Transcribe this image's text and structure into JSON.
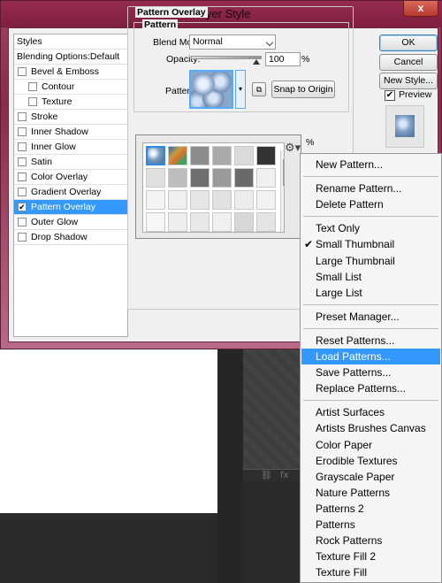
{
  "dialog": {
    "title": "Layer Style",
    "close_glyph": "x"
  },
  "styles_panel": {
    "items": [
      {
        "label": "Styles",
        "type": "header"
      },
      {
        "label": "Blending Options:Default",
        "type": "header"
      },
      {
        "label": "Bevel & Emboss",
        "checked": false
      },
      {
        "label": "Contour",
        "checked": false,
        "sub": true
      },
      {
        "label": "Texture",
        "checked": false,
        "sub": true
      },
      {
        "label": "Stroke",
        "checked": false
      },
      {
        "label": "Inner Shadow",
        "checked": false
      },
      {
        "label": "Inner Glow",
        "checked": false
      },
      {
        "label": "Satin",
        "checked": false
      },
      {
        "label": "Color Overlay",
        "checked": false
      },
      {
        "label": "Gradient Overlay",
        "checked": false
      },
      {
        "label": "Pattern Overlay",
        "checked": true,
        "selected": true
      },
      {
        "label": "Outer Glow",
        "checked": false
      },
      {
        "label": "Drop Shadow",
        "checked": false
      }
    ],
    "check_glyph": "✔"
  },
  "pattern_overlay": {
    "group_title": "Pattern Overlay",
    "subgroup_title": "Pattern",
    "blend_mode_label": "Blend Mode:",
    "blend_mode_value": "Normal",
    "opacity_label": "Opacity:",
    "opacity_value": "100",
    "opacity_level": 0.92,
    "percent": "%",
    "pattern_label": "Pattern:",
    "snap_button": "Snap to Origin",
    "dropdown_glyph": "▾",
    "new_preset_glyph": "⧉"
  },
  "picker": {
    "gear_glyph": "⚙▾",
    "up_glyph": "▲",
    "down_glyph": "▼",
    "percent": "%",
    "rows": [
      [
        {
          "color": "#9fb5d0",
          "selected": true
        },
        {
          "color": "#c8a060",
          "colorful": true
        },
        {
          "color": "#8c8c8c"
        },
        {
          "color": "#aaaaaa"
        },
        {
          "color": "#dadada"
        },
        {
          "color": "#333333"
        }
      ],
      [
        {
          "color": "#e0e0e0"
        },
        {
          "color": "#bdbdbd"
        },
        {
          "color": "#6e6e6e"
        },
        {
          "color": "#9a9a9a"
        },
        {
          "color": "#6a6a6a"
        },
        {
          "color": "#f0f0f0"
        }
      ],
      [
        {
          "color": "#f4f4f4"
        },
        {
          "color": "#efefef"
        },
        {
          "color": "#e6e6e6"
        },
        {
          "color": "#e2e2e2"
        },
        {
          "color": "#ececec"
        },
        {
          "color": "#f2f2f2"
        }
      ],
      [
        {
          "color": "#f6f6f6"
        },
        {
          "color": "#eeeeee"
        },
        {
          "color": "#e8e8e8"
        },
        {
          "color": "#f0f0f0"
        },
        {
          "color": "#d8d8d8"
        },
        {
          "color": "#e4e4e4"
        }
      ]
    ]
  },
  "buttons": {
    "ok": "OK",
    "cancel": "Cancel",
    "new_style": "New Style...",
    "preview_label": "Preview",
    "preview_checked": true,
    "preview_check_glyph": "✔"
  },
  "workspace": {
    "strip_glyphs": [
      "⛓",
      "fx",
      "◘",
      "◑",
      "▭"
    ]
  },
  "menu": {
    "check_glyph": "✔",
    "groups": [
      [
        {
          "label": "New Pattern..."
        }
      ],
      [
        {
          "label": "Rename Pattern..."
        },
        {
          "label": "Delete Pattern"
        }
      ],
      [
        {
          "label": "Text Only"
        },
        {
          "label": "Small Thumbnail",
          "checked": true
        },
        {
          "label": "Large Thumbnail"
        },
        {
          "label": "Small List"
        },
        {
          "label": "Large List"
        }
      ],
      [
        {
          "label": "Preset Manager..."
        }
      ],
      [
        {
          "label": "Reset Patterns..."
        },
        {
          "label": "Load Patterns...",
          "highlighted": true
        },
        {
          "label": "Save Patterns..."
        },
        {
          "label": "Replace Patterns..."
        }
      ],
      [
        {
          "label": "Artist Surfaces"
        },
        {
          "label": "Artists Brushes Canvas"
        },
        {
          "label": "Color Paper"
        },
        {
          "label": "Erodible Textures"
        },
        {
          "label": "Grayscale Paper"
        },
        {
          "label": "Nature Patterns"
        },
        {
          "label": "Patterns 2"
        },
        {
          "label": "Patterns"
        },
        {
          "label": "Rock Patterns"
        },
        {
          "label": "Texture Fill 2"
        },
        {
          "label": "Texture Fill"
        }
      ]
    ]
  }
}
